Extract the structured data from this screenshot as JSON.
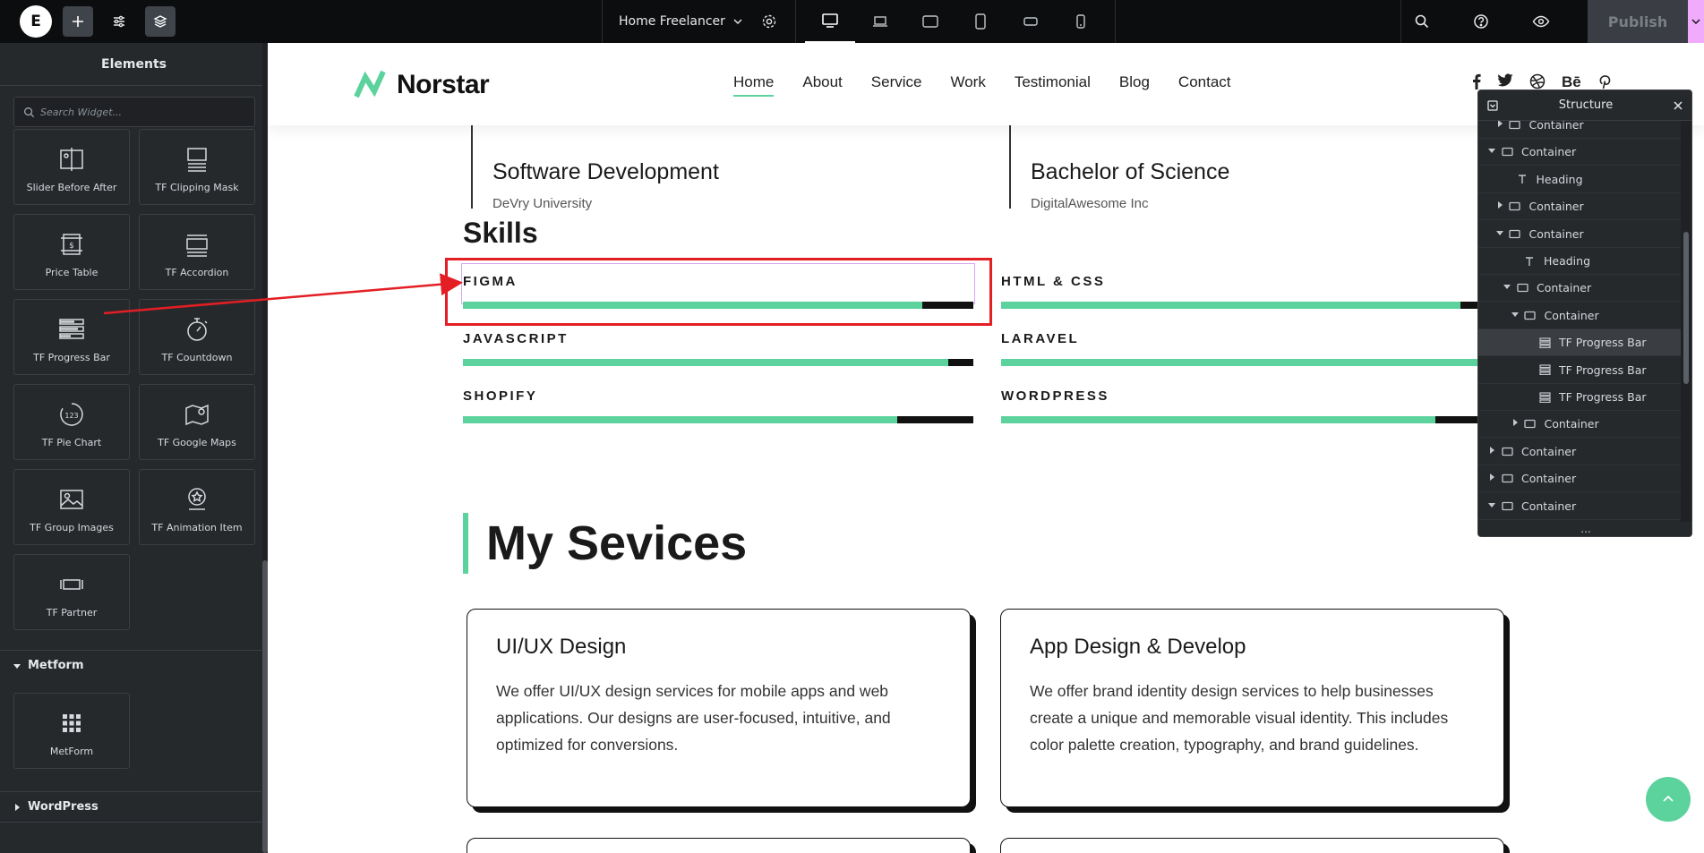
{
  "topbar": {
    "logo_letter": "E",
    "page_name": "Home Freelancer",
    "publish_label": "Publish"
  },
  "panel": {
    "title": "Elements",
    "search_placeholder": "Search Widget...",
    "widgets": [
      {
        "label": "Slider Before After",
        "icon": "slider-before-after-icon"
      },
      {
        "label": "TF Clipping Mask",
        "icon": "clipping-mask-icon"
      },
      {
        "label": "Price Table",
        "icon": "price-table-icon"
      },
      {
        "label": "TF Accordion",
        "icon": "accordion-icon"
      },
      {
        "label": "TF Progress Bar",
        "icon": "progress-bar-icon"
      },
      {
        "label": "TF Countdown",
        "icon": "countdown-icon"
      },
      {
        "label": "TF Pie Chart",
        "icon": "pie-chart-icon"
      },
      {
        "label": "TF Google Maps",
        "icon": "google-maps-icon"
      },
      {
        "label": "TF Group Images",
        "icon": "group-images-icon"
      },
      {
        "label": "TF Animation Item",
        "icon": "animation-item-icon"
      },
      {
        "label": "TF Partner",
        "icon": "partner-icon"
      }
    ],
    "pie_icon_text": "123",
    "sections": {
      "metform": "Metform",
      "metform_widget": "MetForm",
      "wordpress": "WordPress"
    }
  },
  "site": {
    "brand": "Norstar",
    "nav": [
      "Home",
      "About",
      "Service",
      "Work",
      "Testimonial",
      "Blog",
      "Contact"
    ],
    "socials": {
      "behance": "Bē"
    },
    "education": [
      {
        "title": "Software Development",
        "sub": "DeVry University"
      },
      {
        "title": "Bachelor of Science",
        "sub": "DigitalAwesome Inc"
      }
    ],
    "skills_title": "Skills",
    "skills": [
      {
        "name": "FIGMA",
        "percent": 90
      },
      {
        "name": "HTML & CSS",
        "percent": 90
      },
      {
        "name": "JAVASCRIPT",
        "percent": 95
      },
      {
        "name": "LARAVEL",
        "percent": 95
      },
      {
        "name": "SHOPIFY",
        "percent": 85
      },
      {
        "name": "WORDPRESS",
        "percent": 85
      }
    ],
    "services_title": "My Sevices",
    "services": [
      {
        "title": "UI/UX Design",
        "desc": "We offer UI/UX design services for mobile apps and web applications. Our designs are user-focused, intuitive, and optimized for conversions."
      },
      {
        "title": "App Design & Develop",
        "desc": "We offer brand identity design services to help businesses create a unique and memorable visual identity. This includes color palette creation, typography, and brand guidelines."
      }
    ]
  },
  "structure": {
    "title": "Structure",
    "footer": "...",
    "rows": [
      {
        "label": "Container",
        "depth": 1,
        "caret": "right",
        "type": "container"
      },
      {
        "label": "Container",
        "depth": 0,
        "caret": "down",
        "type": "container"
      },
      {
        "label": "Heading",
        "depth": 1,
        "caret": "",
        "type": "heading"
      },
      {
        "label": "Container",
        "depth": 1,
        "caret": "right",
        "type": "container"
      },
      {
        "label": "Container",
        "depth": 1,
        "caret": "down",
        "type": "container"
      },
      {
        "label": "Heading",
        "depth": 2,
        "caret": "",
        "type": "heading"
      },
      {
        "label": "Container",
        "depth": 2,
        "caret": "down",
        "type": "container"
      },
      {
        "label": "Container",
        "depth": 3,
        "caret": "down",
        "type": "container"
      },
      {
        "label": "TF Progress Bar",
        "depth": 4,
        "caret": "",
        "type": "progress",
        "selected": true
      },
      {
        "label": "TF Progress Bar",
        "depth": 4,
        "caret": "",
        "type": "progress"
      },
      {
        "label": "TF Progress Bar",
        "depth": 4,
        "caret": "",
        "type": "progress"
      },
      {
        "label": "Container",
        "depth": 3,
        "caret": "right",
        "type": "container"
      },
      {
        "label": "Container",
        "depth": 0,
        "caret": "right",
        "type": "container"
      },
      {
        "label": "Container",
        "depth": 0,
        "caret": "right",
        "type": "container"
      },
      {
        "label": "Container",
        "depth": 0,
        "caret": "down",
        "type": "container"
      }
    ]
  },
  "colors": {
    "accent_green": "#5cd29d",
    "annotation_red": "#e31e24",
    "editor_dark": "#26292c"
  }
}
